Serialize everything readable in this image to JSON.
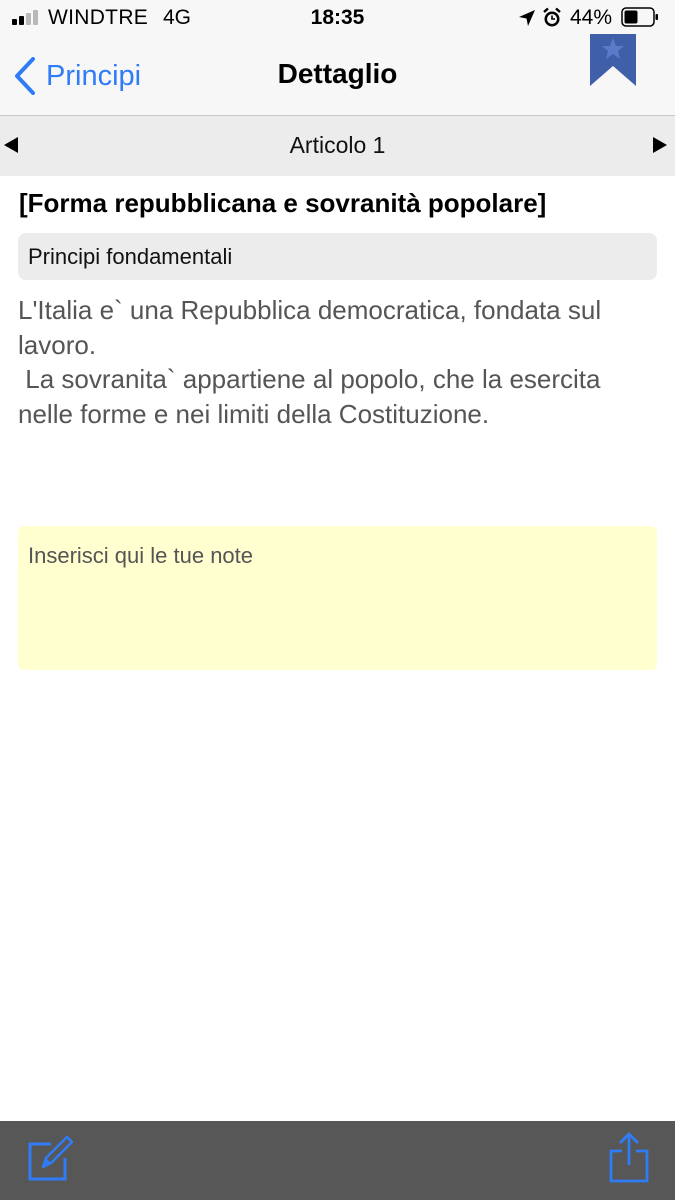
{
  "status_bar": {
    "carrier": "WINDTRE",
    "network": "4G",
    "time": "18:35",
    "battery_percent": "44%",
    "icons": [
      "signal-icon",
      "location-icon",
      "alarm-icon",
      "battery-icon"
    ]
  },
  "nav": {
    "back_label": "Principi",
    "title": "Dettaglio",
    "bookmark_icon": "bookmark-icon"
  },
  "article_nav": {
    "label": "Articolo 1",
    "prev_icon": "triangle-left-icon",
    "next_icon": "triangle-right-icon"
  },
  "article": {
    "title": "[Forma repubblicana e sovranità popolare]",
    "section": "Principi fondamentali",
    "body": "L'Italia e` una Repubblica democratica, fondata sul lavoro.\n La sovranita` appartiene al popolo, che la esercita nelle forme e nei limiti della Costituzione."
  },
  "notes": {
    "placeholder": "Inserisci qui le tue note"
  },
  "toolbar": {
    "edit_icon": "edit-icon",
    "share_icon": "share-icon"
  },
  "colors": {
    "accent": "#2f7cf6",
    "bookmark": "#3f5fa8",
    "notes_background": "#ffffd0",
    "toolbar_background": "#575757"
  }
}
